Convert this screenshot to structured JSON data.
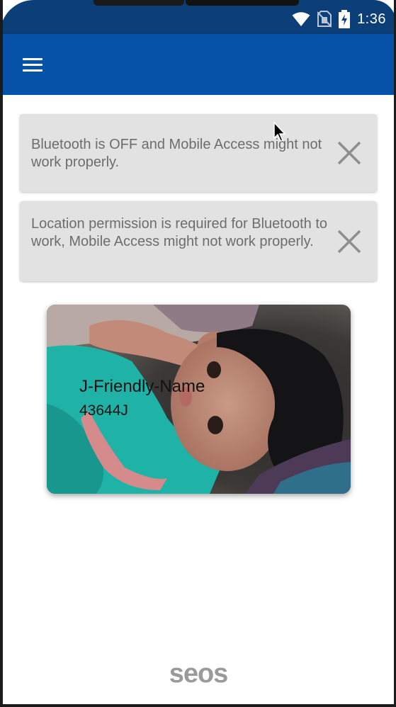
{
  "status_bar": {
    "time": "1:36",
    "icons": [
      "wifi-icon",
      "no-sim-icon",
      "battery-charging-icon"
    ]
  },
  "app_bar": {
    "menu_icon": "hamburger-menu-icon",
    "colors": {
      "app_bar": "#0552a8",
      "status_bar": "#0c3f78"
    }
  },
  "alerts": [
    {
      "text": "Bluetooth is OFF and Mobile Access might not work properly.",
      "close_icon": "close-icon"
    },
    {
      "text": "Location permission is required for Bluetooth to work, Mobile Access might not work properly.",
      "close_icon": "close-icon"
    }
  ],
  "card": {
    "name": "J-Friendly-Name",
    "id": "43644J",
    "background": "photo"
  },
  "footer": {
    "logo": "seos"
  }
}
